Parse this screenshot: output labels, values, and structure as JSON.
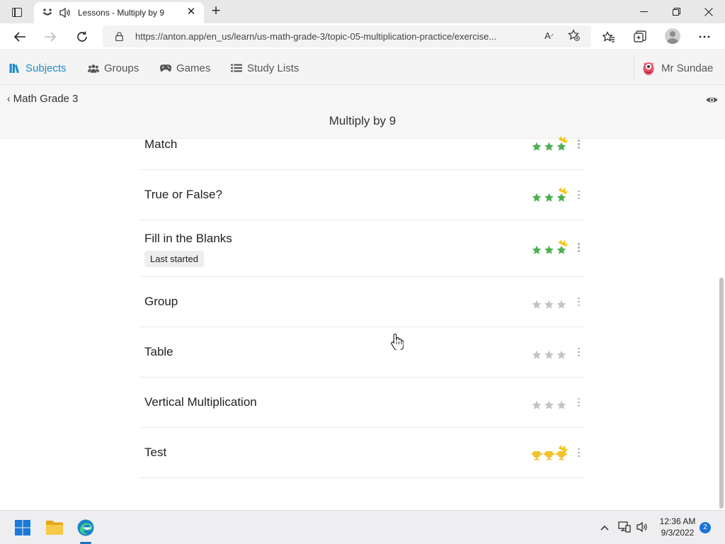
{
  "browser": {
    "tab_title": "Lessons - Multiply by 9",
    "url": "https://anton.app/en_us/learn/us-math-grade-3/topic-05-multiplication-practice/exercise...",
    "icons": [
      "tab-actions-icon",
      "app-favicon-icon",
      "audio-playing-icon",
      "close-tab-icon",
      "new-tab-icon",
      "minimize-icon",
      "restore-icon",
      "close-window-icon",
      "back-icon",
      "forward-icon",
      "refresh-icon",
      "lock-icon",
      "read-aloud-icon",
      "add-favorite-icon",
      "favorites-icon",
      "collections-icon",
      "profile-icon",
      "more-menu-icon"
    ]
  },
  "site_nav": {
    "items": [
      {
        "label": "Subjects",
        "icon": "books-icon",
        "active": true
      },
      {
        "label": "Groups",
        "icon": "groups-icon",
        "active": false
      },
      {
        "label": "Games",
        "icon": "gamepad-icon",
        "active": false
      },
      {
        "label": "Study Lists",
        "icon": "list-icon",
        "active": false
      }
    ],
    "user_name": "Mr Sundae",
    "accent_color": "#1a8ccc"
  },
  "page": {
    "back_label": "Math Grade 3",
    "title": "Multiply by 9"
  },
  "lessons": [
    {
      "name": "Match",
      "badge": "",
      "stars": 3,
      "star_type": "star",
      "crowned": true
    },
    {
      "name": "True or False?",
      "badge": "",
      "stars": 3,
      "star_type": "star",
      "crowned": true
    },
    {
      "name": "Fill in the Blanks",
      "badge": "Last started",
      "stars": 3,
      "star_type": "star",
      "crowned": true
    },
    {
      "name": "Group",
      "badge": "",
      "stars": 0,
      "star_type": "star",
      "crowned": false
    },
    {
      "name": "Table",
      "badge": "",
      "stars": 0,
      "star_type": "star",
      "crowned": false
    },
    {
      "name": "Vertical Multiplication",
      "badge": "",
      "stars": 0,
      "star_type": "star",
      "crowned": false
    },
    {
      "name": "Test",
      "badge": "",
      "stars": 3,
      "star_type": "trophy",
      "crowned": true
    }
  ],
  "colors": {
    "star_earned": "#4caf50",
    "star_empty": "#c4c4c4",
    "trophy": "#f2c12e",
    "crown": "#f5c518"
  },
  "taskbar": {
    "time": "12:36 AM",
    "date": "9/3/2022",
    "notifications": "2",
    "icons": [
      "windows-start-icon",
      "file-explorer-icon",
      "edge-icon",
      "tray-chevron-icon",
      "network-icon",
      "volume-icon"
    ]
  }
}
